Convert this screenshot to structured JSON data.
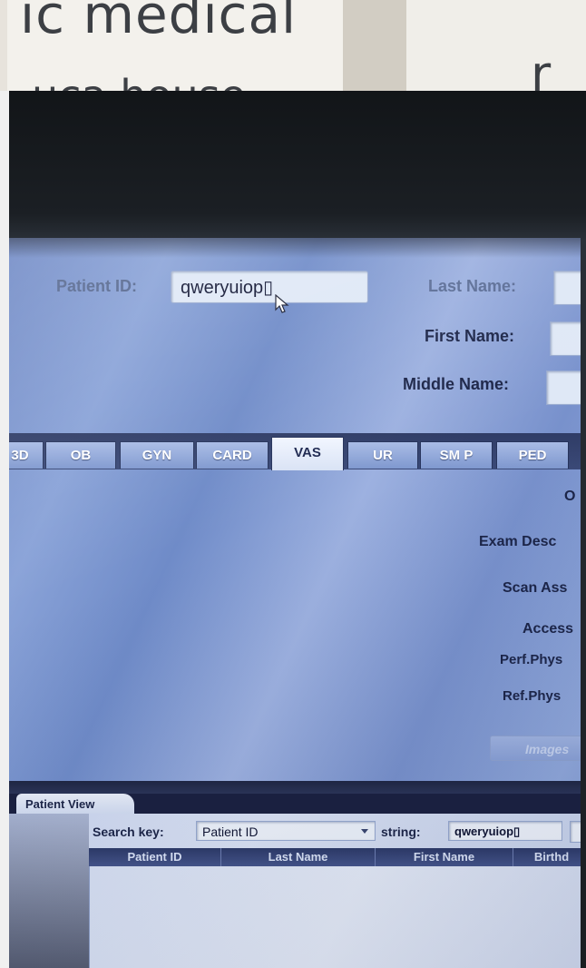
{
  "wall": {
    "sign_text_1": "ic medical",
    "sign_text_2": "r",
    "sign_text_3": "uca house"
  },
  "patient": {
    "id_label": "Patient ID:",
    "id_value": "qweryuiop▯",
    "last_name_label": "Last Name:",
    "first_name_label": "First Name:",
    "middle_name_label": "Middle Name:"
  },
  "tabs": [
    {
      "label": "3D"
    },
    {
      "label": "OB"
    },
    {
      "label": "GYN"
    },
    {
      "label": "CARD"
    },
    {
      "label": "VAS",
      "active": true
    },
    {
      "label": "UR"
    },
    {
      "label": "SM P"
    },
    {
      "label": "PED"
    }
  ],
  "exam": {
    "operator_label": "O",
    "exam_desc_label": "Exam Desc",
    "scan_ass_label": "Scan Ass",
    "accession_label": "Access",
    "perf_phys_label": "Perf.Phys",
    "ref_phys_label": "Ref.Phys",
    "images_button": "Images"
  },
  "patient_view": {
    "tab_label": "Patient View",
    "search_key_label": "Search key:",
    "search_key_value": "Patient ID",
    "string_label": "string:",
    "string_value": "qweryuiop▯",
    "columns": [
      "Patient ID",
      "Last Name",
      "First Name",
      "Birthd"
    ]
  },
  "colors": {
    "screen_blue": "#7f98cf",
    "active_tab": "#f2f6ff",
    "header_navy": "#2d3a68"
  },
  "icons": {
    "cursor": "mouse-pointer-icon",
    "dropdown": "chevron-down-icon"
  }
}
